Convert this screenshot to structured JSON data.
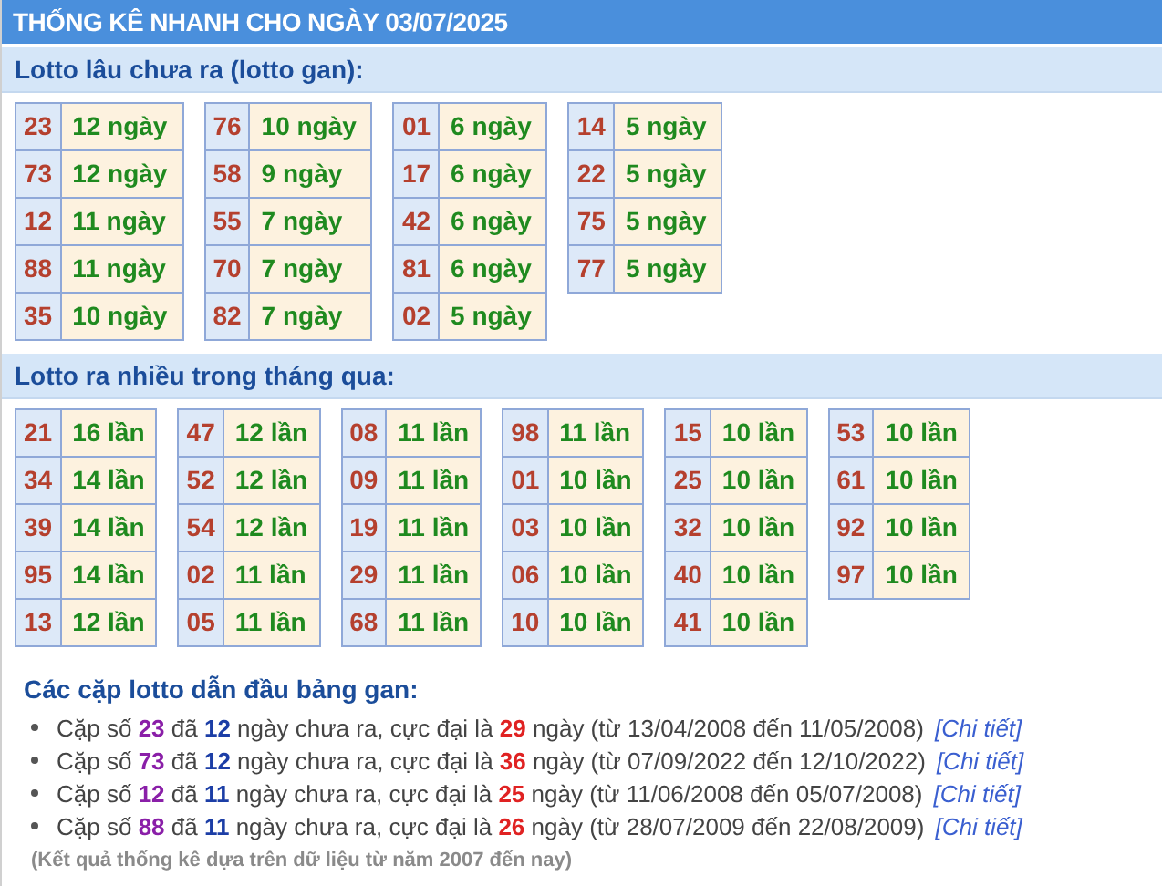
{
  "title": "THỐNG KÊ NHANH CHO NGÀY 03/07/2025",
  "sections": [
    {
      "heading": "Lotto lâu chưa ra (lotto gan):",
      "tables": [
        [
          {
            "number": "23",
            "count": "12 ngày"
          },
          {
            "number": "73",
            "count": "12 ngày"
          },
          {
            "number": "12",
            "count": "11 ngày"
          },
          {
            "number": "88",
            "count": "11 ngày"
          },
          {
            "number": "35",
            "count": "10 ngày"
          }
        ],
        [
          {
            "number": "76",
            "count": "10 ngày"
          },
          {
            "number": "58",
            "count": "9 ngày"
          },
          {
            "number": "55",
            "count": "7 ngày"
          },
          {
            "number": "70",
            "count": "7 ngày"
          },
          {
            "number": "82",
            "count": "7 ngày"
          }
        ],
        [
          {
            "number": "01",
            "count": "6 ngày"
          },
          {
            "number": "17",
            "count": "6 ngày"
          },
          {
            "number": "42",
            "count": "6 ngày"
          },
          {
            "number": "81",
            "count": "6 ngày"
          },
          {
            "number": "02",
            "count": "5 ngày"
          }
        ],
        [
          {
            "number": "14",
            "count": "5 ngày"
          },
          {
            "number": "22",
            "count": "5 ngày"
          },
          {
            "number": "75",
            "count": "5 ngày"
          },
          {
            "number": "77",
            "count": "5 ngày"
          }
        ]
      ]
    },
    {
      "heading": "Lotto ra nhiều trong tháng qua:",
      "tables": [
        [
          {
            "number": "21",
            "count": "16 lần"
          },
          {
            "number": "34",
            "count": "14 lần"
          },
          {
            "number": "39",
            "count": "14 lần"
          },
          {
            "number": "95",
            "count": "14 lần"
          },
          {
            "number": "13",
            "count": "12 lần"
          }
        ],
        [
          {
            "number": "47",
            "count": "12 lần"
          },
          {
            "number": "52",
            "count": "12 lần"
          },
          {
            "number": "54",
            "count": "12 lần"
          },
          {
            "number": "02",
            "count": "11 lần"
          },
          {
            "number": "05",
            "count": "11 lần"
          }
        ],
        [
          {
            "number": "08",
            "count": "11 lần"
          },
          {
            "number": "09",
            "count": "11 lần"
          },
          {
            "number": "19",
            "count": "11 lần"
          },
          {
            "number": "29",
            "count": "11 lần"
          },
          {
            "number": "68",
            "count": "11 lần"
          }
        ],
        [
          {
            "number": "98",
            "count": "11 lần"
          },
          {
            "number": "01",
            "count": "10 lần"
          },
          {
            "number": "03",
            "count": "10 lần"
          },
          {
            "number": "06",
            "count": "10 lần"
          },
          {
            "number": "10",
            "count": "10 lần"
          }
        ],
        [
          {
            "number": "15",
            "count": "10 lần"
          },
          {
            "number": "25",
            "count": "10 lần"
          },
          {
            "number": "32",
            "count": "10 lần"
          },
          {
            "number": "40",
            "count": "10 lần"
          },
          {
            "number": "41",
            "count": "10 lần"
          }
        ],
        [
          {
            "number": "53",
            "count": "10 lần"
          },
          {
            "number": "61",
            "count": "10 lần"
          },
          {
            "number": "92",
            "count": "10 lần"
          },
          {
            "number": "97",
            "count": "10 lần"
          }
        ]
      ]
    }
  ],
  "leaders": {
    "heading": "Các cặp lotto dẫn đầu bảng gan:",
    "items": [
      {
        "segments": [
          {
            "kind": "plain",
            "text": "Cặp số "
          },
          {
            "kind": "pair",
            "text": "23"
          },
          {
            "kind": "plain",
            "text": " đã "
          },
          {
            "kind": "days",
            "text": "12"
          },
          {
            "kind": "plain",
            "text": " ngày chưa ra, cực đại là "
          },
          {
            "kind": "max",
            "text": "29"
          },
          {
            "kind": "plain",
            "text": " ngày (từ 13/04/2008 đến 11/05/2008)"
          }
        ],
        "link": "[Chi tiết]"
      },
      {
        "segments": [
          {
            "kind": "plain",
            "text": "Cặp số "
          },
          {
            "kind": "pair",
            "text": "73"
          },
          {
            "kind": "plain",
            "text": " đã "
          },
          {
            "kind": "days",
            "text": "12"
          },
          {
            "kind": "plain",
            "text": " ngày chưa ra, cực đại là "
          },
          {
            "kind": "max",
            "text": "36"
          },
          {
            "kind": "plain",
            "text": " ngày (từ 07/09/2022 đến 12/10/2022)"
          }
        ],
        "link": "[Chi tiết]"
      },
      {
        "segments": [
          {
            "kind": "plain",
            "text": "Cặp số "
          },
          {
            "kind": "pair",
            "text": "12"
          },
          {
            "kind": "plain",
            "text": " đã "
          },
          {
            "kind": "days",
            "text": "11"
          },
          {
            "kind": "plain",
            "text": " ngày chưa ra, cực đại là "
          },
          {
            "kind": "max",
            "text": "25"
          },
          {
            "kind": "plain",
            "text": " ngày (từ 11/06/2008 đến 05/07/2008)"
          }
        ],
        "link": "[Chi tiết]"
      },
      {
        "segments": [
          {
            "kind": "plain",
            "text": "Cặp số "
          },
          {
            "kind": "pair",
            "text": "88"
          },
          {
            "kind": "plain",
            "text": " đã "
          },
          {
            "kind": "days",
            "text": "11"
          },
          {
            "kind": "plain",
            "text": " ngày chưa ra, cực đại là "
          },
          {
            "kind": "max",
            "text": "26"
          },
          {
            "kind": "plain",
            "text": " ngày (từ 28/07/2009 đến 22/08/2009)"
          }
        ],
        "link": "[Chi tiết]"
      }
    ]
  },
  "note": "(Kết quả thống kê dựa trên dữ liệu từ năm 2007 đến nay)"
}
